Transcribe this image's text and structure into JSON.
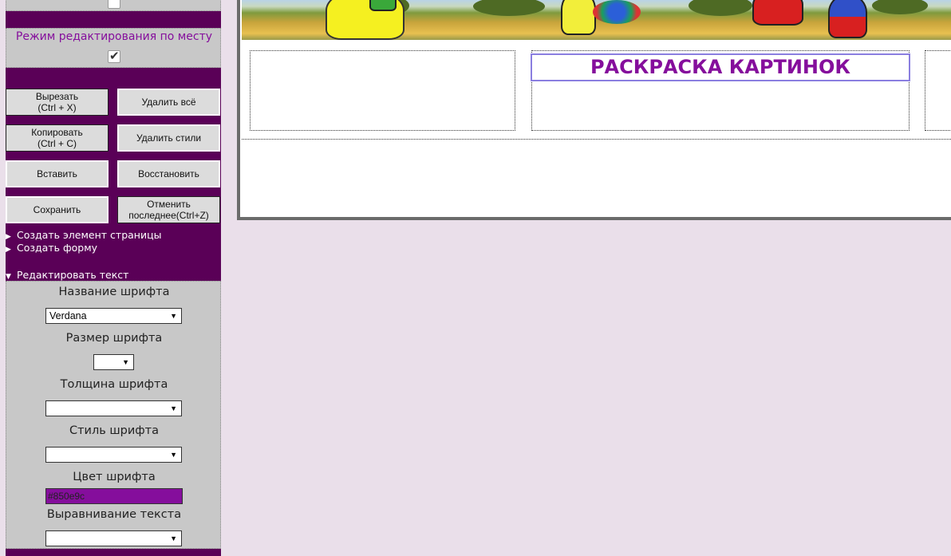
{
  "sidebar": {
    "inplace_edit_label": "Режим редактирования по месту",
    "inplace_edit_checked": true,
    "top_checkbox_checked": false,
    "buttons": {
      "cut": "Вырезать\n(Ctrl + X)",
      "delete_all": "Удалить всё",
      "copy": "Копировать\n(Ctrl + C)",
      "delete_styles": "Удалить стили",
      "paste": "Вставить",
      "restore": "Восстановить",
      "save": "Сохранить",
      "undo": "Отменить\nпоследнее(Ctrl+Z)"
    },
    "menu": {
      "create_element": "Создать элемент страницы",
      "create_form": "Создать форму",
      "edit_text": "Редактировать текст"
    },
    "text_panel": {
      "font_name_label": "Название шрифта",
      "font_name_value": "Verdana",
      "font_size_label": "Размер шрифта",
      "font_size_value": "",
      "font_weight_label": "Толщина шрифта",
      "font_weight_value": "",
      "font_style_label": "Стиль шрифта",
      "font_style_value": "",
      "font_color_label": "Цвет шрифта",
      "font_color_value": "#850e9c",
      "text_align_label": "Выравнивание текста",
      "text_align_value": ""
    }
  },
  "main": {
    "heading": "РАСКРАСКА КАРТИНОК"
  },
  "colors": {
    "sidebar_bg": "#5a0057",
    "panel_bg": "#c8c8c8",
    "accent": "#850e9c",
    "page_bg": "#eadfea"
  },
  "icons": [
    "checkbox-icon",
    "triangle-right-icon",
    "triangle-down-icon",
    "dropdown-caret-icon"
  ]
}
